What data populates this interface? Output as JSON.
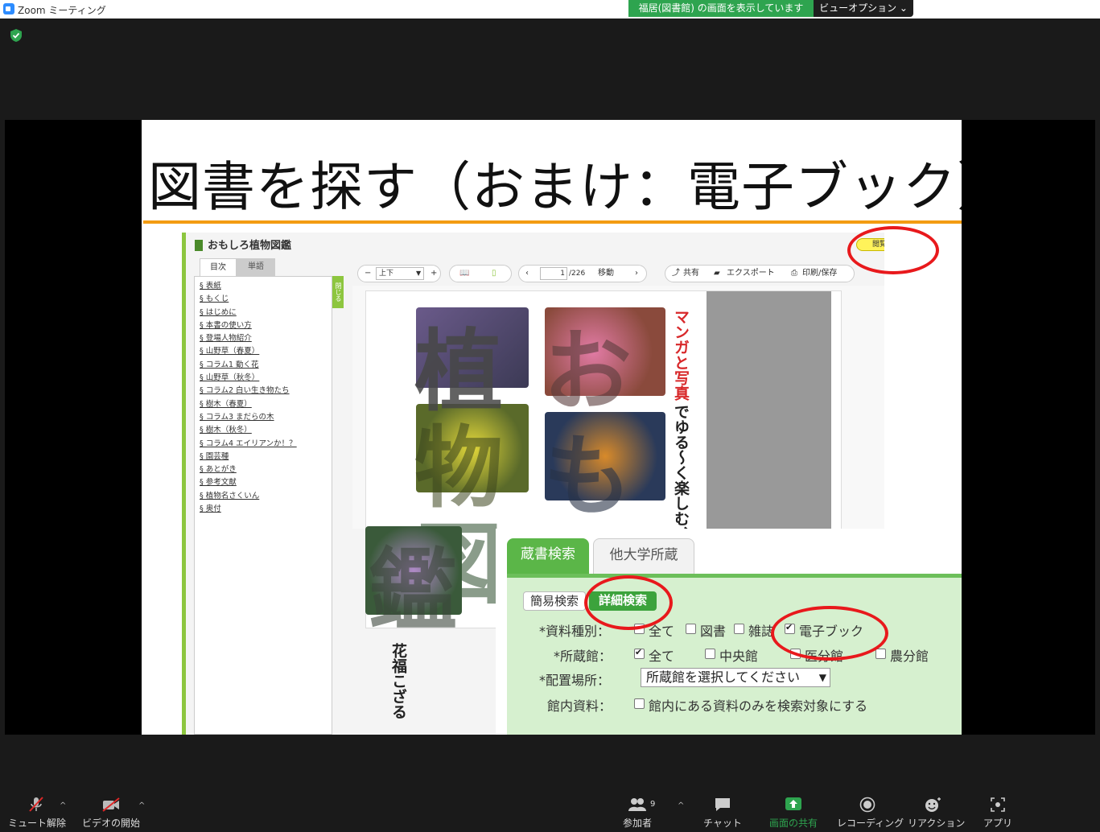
{
  "window": {
    "app_title": "Zoom ミーティング"
  },
  "share": {
    "banner": "福居(図書館) の画面を表示しています",
    "view_options": "ビューオプション ⌄"
  },
  "slide": {
    "title": "図書を探す（おまけ：電子ブック）"
  },
  "viewer": {
    "book_title": "おもしろ植物図鑑",
    "end_button": "閲覧終了",
    "toc_tabs": [
      "目次",
      "単語"
    ],
    "close_tab": "閉じる",
    "toc_items": [
      "§ 表紙",
      "§ もくじ",
      "§ はじめに",
      "§ 本書の使い方",
      "§ 登場人物紹介",
      "§ 山野草（春夏）",
      "§ コラム1 動く花",
      "§ 山野草（秋冬）",
      "§ コラム2 白い生き物たち",
      "§ 樹木（春夏）",
      "§ コラム3 まだらの木",
      "§ 樹木（秋冬）",
      "§ コラム4 エイリアンか！？",
      "§ 園芸種",
      "§ あとがき",
      "§ 参考文献",
      "§ 植物名さくいん",
      "§ 奥付"
    ],
    "toolbar": {
      "layout_value": "上下",
      "page_value": "1",
      "page_total": "/226",
      "move_label": "移動",
      "share_label": "共有",
      "export_label": "エクスポート",
      "print_label": "印刷/保存"
    },
    "cover": {
      "red_text_a": "マンガと写真",
      "black_text_a": "でゆる〜く楽しむ、",
      "author": "花福こざる",
      "kanji": [
        "植",
        "物",
        "図",
        "鑑",
        "お",
        "も"
      ]
    }
  },
  "search": {
    "tabs": [
      "蔵書検索",
      "他大学所蔵"
    ],
    "mode_tabs": [
      "簡易検索",
      "詳細検索"
    ],
    "material_type": {
      "label": "*資料種別：",
      "options": [
        {
          "label": "全て",
          "checked": false
        },
        {
          "label": "図書",
          "checked": false
        },
        {
          "label": "雑誌",
          "checked": false
        },
        {
          "label": "電子ブック",
          "checked": true
        }
      ]
    },
    "holding": {
      "label": "*所蔵館：",
      "options": [
        {
          "label": "全て",
          "checked": true
        },
        {
          "label": "中央館",
          "checked": false
        },
        {
          "label": "医分館",
          "checked": false
        },
        {
          "label": "農分館",
          "checked": false
        }
      ]
    },
    "location": {
      "label": "*配置場所：",
      "placeholder": "所蔵館を選択してください"
    },
    "in_library": {
      "label": "館内資料：",
      "option": "館内にある資料のみを検索対象にする"
    }
  },
  "bottombar": {
    "mute": "ミュート解除",
    "video": "ビデオの開始",
    "participants": "参加者",
    "participants_count": "9",
    "chat": "チャット",
    "share": "画面の共有",
    "record": "レコーディング",
    "reactions": "リアクション",
    "apps": "アプリ"
  },
  "colors": {
    "zoom_green": "#2ea44f",
    "library_green": "#5bb648",
    "annotation_red": "#e8191c",
    "title_underline": "#f39c12"
  }
}
